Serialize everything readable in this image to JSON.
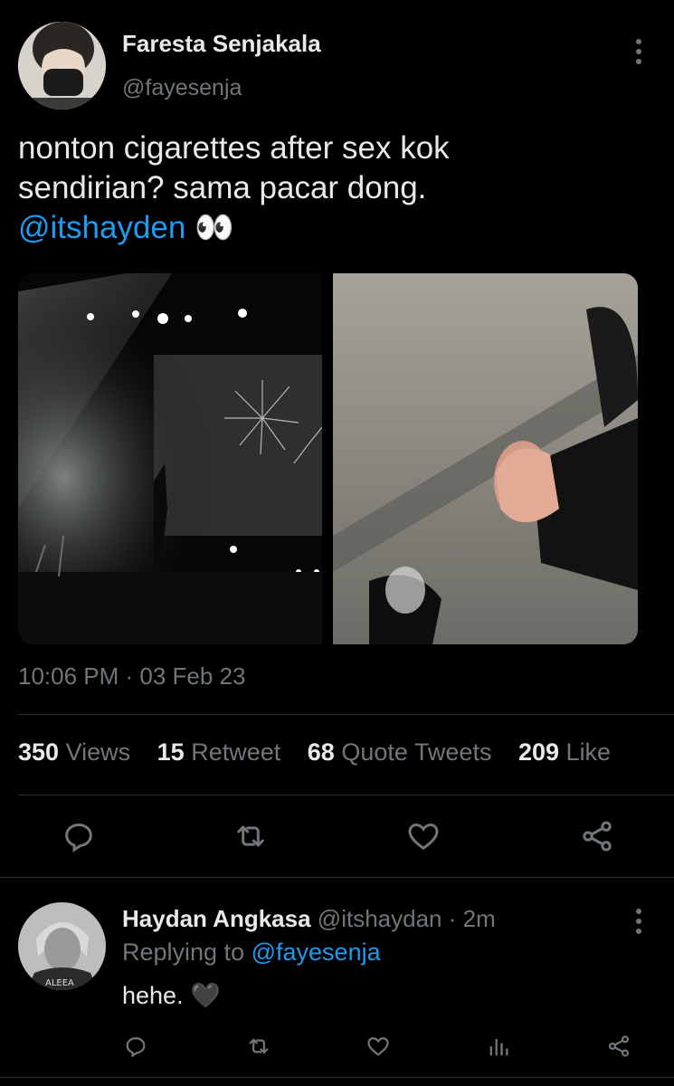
{
  "tweet": {
    "author_name": "Faresta Senjakala",
    "author_handle": "@fayesenja",
    "text_line1": "nonton cigarettes after sex kok",
    "text_line2": "sendirian? sama pacar dong.",
    "mention": "@itshayden",
    "emoji": "👀",
    "timestamp": "10:06 PM · 03 Feb 23",
    "stats": {
      "views_count": "350",
      "views_label": "Views",
      "retweets_count": "15",
      "retweets_label": "Retweet",
      "quotes_count": "68",
      "quotes_label": "Quote Tweets",
      "likes_count": "209",
      "likes_label": "Like"
    }
  },
  "reply": {
    "author_name": "Haydan Angkasa",
    "author_handle": "@itshaydan",
    "separator": "·",
    "time": "2m",
    "replying_to_label": "Replying to",
    "replying_to_handle": "@fayesenja",
    "text": "hehe.",
    "emoji": "🖤"
  },
  "icons": {
    "reply": "reply-icon",
    "retweet": "retweet-icon",
    "like": "heart-icon",
    "share": "share-icon",
    "analytics": "analytics-icon",
    "more": "more-icon"
  },
  "colors": {
    "background": "#000000",
    "text": "#e7e9ea",
    "secondary": "#71767b",
    "link": "#1d9bf0",
    "divider": "#2f3336"
  }
}
